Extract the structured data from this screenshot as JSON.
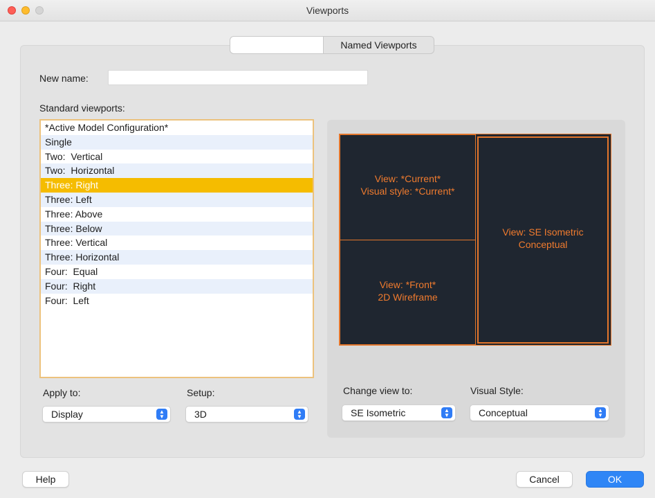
{
  "window": {
    "title": "Viewports"
  },
  "tabs": [
    {
      "label": ""
    },
    {
      "label": "Named Viewports"
    }
  ],
  "new_name": {
    "label": "New name:",
    "value": ""
  },
  "standard_viewports": {
    "label": "Standard viewports:",
    "selected": "Three: Right",
    "items": [
      "*Active Model Configuration*",
      "Single",
      "Two:  Vertical",
      "Two:  Horizontal",
      "Three: Right",
      "Three: Left",
      "Three: Above",
      "Three: Below",
      "Three: Vertical",
      "Three: Horizontal",
      "Four:  Equal",
      "Four:  Right",
      "Four:  Left"
    ]
  },
  "apply_to": {
    "label": "Apply to:",
    "value": "Display"
  },
  "setup": {
    "label": "Setup:",
    "value": "3D"
  },
  "preview": {
    "top_left": {
      "line1": "View: *Current*",
      "line2": "Visual style: *Current*"
    },
    "bottom_left": {
      "line1": "View: *Front*",
      "line2": "2D Wireframe"
    },
    "right": {
      "line1": "View: SE Isometric",
      "line2": "Conceptual"
    }
  },
  "change_view_to": {
    "label": "Change view to:",
    "value": "SE Isometric"
  },
  "visual_style": {
    "label": "Visual Style:",
    "value": "Conceptual"
  },
  "buttons": {
    "help": "Help",
    "cancel": "Cancel",
    "ok": "OK"
  },
  "colors": {
    "selection": "#f5bc00",
    "preview_bg": "#1f2630",
    "preview_accent": "#e4762b",
    "primary_button": "#2f86f6"
  }
}
